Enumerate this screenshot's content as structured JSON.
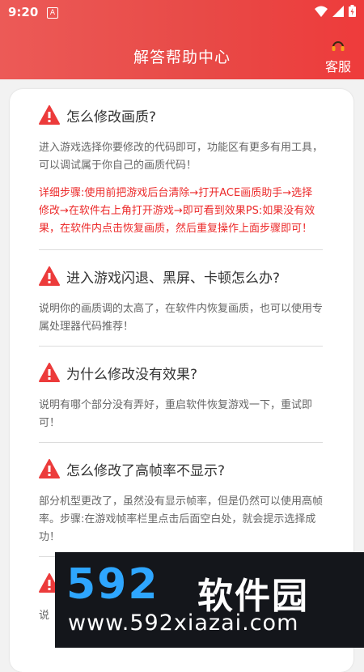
{
  "status": {
    "time": "9:20",
    "badge": "A"
  },
  "header": {
    "title": "解答帮助中心",
    "service_label": "客服"
  },
  "faqs": [
    {
      "question": "怎么修改画质?",
      "answer": "进入游戏选择你要修改的代码即可，功能区有更多有用工具，可以调试属于你自己的画质代码！",
      "detail": "详细步骤:使用前把游戏后台清除→打开ACE画质助手→选择修改→在软件右上角打开游戏→即可看到效果PS:如果没有效果，在软件内点击恢复画质，然后重复操作上面步骤即可！"
    },
    {
      "question": "进入游戏闪退、黑屏、卡顿怎么办?",
      "answer": "说明你的画质调的太高了，在软件内恢复画质，也可以使用专属处理器代码推荐！"
    },
    {
      "question": "为什么修改没有效果?",
      "answer": "说明有哪个部分没有弄好，重启软件恢复游戏一下，重试即可！"
    },
    {
      "question": "怎么修改了高帧率不显示?",
      "answer": "部分机型更改了，虽然没有显示帧率，但是仍然可以使用高帧率。步骤:在游戏帧率栏里点击后面空白处，就会提示选择成功！"
    },
    {
      "question": "",
      "answer": "说"
    }
  ],
  "watermark": {
    "logo": "592",
    "logo_cn": "软件园",
    "url": "www.592xiazai.com"
  }
}
